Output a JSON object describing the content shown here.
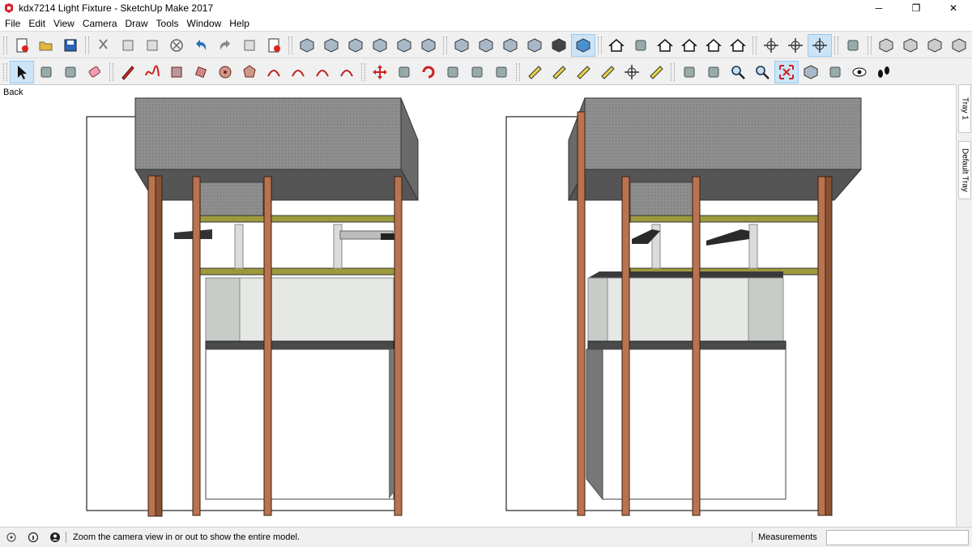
{
  "window": {
    "title": "kdx7214 Light Fixture - SketchUp Make 2017",
    "minimize_glyph": "─",
    "restore_glyph": "❐",
    "close_glyph": "✕"
  },
  "menu": [
    "File",
    "Edit",
    "View",
    "Camera",
    "Draw",
    "Tools",
    "Window",
    "Help"
  ],
  "toolbar_top": {
    "groups": [
      [
        "new-icon",
        "open-icon",
        "save-icon"
      ],
      [
        "cut-icon",
        "copy-icon",
        "paste-icon",
        "erase-icon",
        "undo-icon",
        "redo-icon",
        "print-icon",
        "model-info-icon"
      ],
      [
        "iso-view-icon",
        "top-view-icon",
        "front-view-icon",
        "right-view-icon",
        "back-view-icon",
        "left-view-icon"
      ],
      [
        "xray-icon",
        "back-edges-icon",
        "wireframe-icon",
        "hidden-line-icon",
        "shaded-icon",
        "textured-icon"
      ],
      [
        "warehouse-icon",
        "components-icon",
        "home-icon",
        "house-icon",
        "house-outline-icon",
        "house-share-icon"
      ],
      [
        "axes-icon",
        "section-plane-icon",
        "section-display-icon"
      ],
      [
        "layer-icon"
      ],
      [
        "solid-outer-icon",
        "solid-intersect-icon",
        "solid-union-icon",
        "solid-subtract-icon",
        "solid-trim-icon"
      ]
    ],
    "active": [
      "textured-icon",
      "section-display-icon"
    ]
  },
  "toolbar_bottom": {
    "groups": [
      [
        "select-icon",
        "make-component-icon",
        "paint-bucket-icon",
        "eraser-icon"
      ],
      [
        "pencil-icon",
        "freehand-icon",
        "rectangle-icon",
        "rotated-rectangle-icon",
        "circle-icon",
        "polygon-icon",
        "arc-icon",
        "two-point-arc-icon",
        "three-point-arc-icon",
        "pie-icon"
      ],
      [
        "move-icon",
        "push-pull-icon",
        "rotate-icon",
        "follow-me-icon",
        "scale-icon",
        "offset-icon"
      ],
      [
        "tape-measure-icon",
        "dimension-icon",
        "protractor-icon",
        "text-icon",
        "axes-tool-icon",
        "3d-text-icon"
      ],
      [
        "orbit-icon",
        "pan-icon",
        "zoom-icon",
        "zoom-window-icon",
        "zoom-extents-icon",
        "previous-view-icon",
        "position-camera-icon",
        "look-around-icon",
        "walk-icon"
      ]
    ],
    "active": [
      "select-icon",
      "zoom-extents-icon"
    ]
  },
  "viewport": {
    "scene_label": "Back"
  },
  "tray": {
    "tabs": [
      "Tray 1",
      "Default Tray"
    ]
  },
  "status": {
    "hint": "Zoom the camera view in or out to show the entire model.",
    "measurements_label": "Measurements",
    "measurements_value": ""
  },
  "colors": {
    "wood": "#b87350",
    "wood_edge": "#3b1f12",
    "concrete": "#8a8a8a",
    "concrete_dark": "#5f5f5f",
    "shelf_yellow": "#9c9a3c",
    "glass": "#d4d8d4",
    "active_button": "#cce4f7"
  }
}
